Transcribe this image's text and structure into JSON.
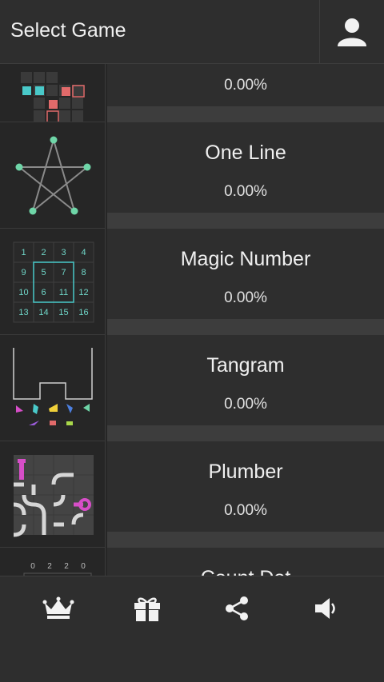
{
  "header": {
    "title": "Select Game",
    "user_icon": "user-icon"
  },
  "games": [
    {
      "name": "",
      "progress": "0.00%"
    },
    {
      "name": "One Line",
      "progress": "0.00%"
    },
    {
      "name": "Magic Number",
      "progress": "0.00%"
    },
    {
      "name": "Tangram",
      "progress": "0.00%"
    },
    {
      "name": "Plumber",
      "progress": "0.00%"
    },
    {
      "name": "Count Dot",
      "progress": ""
    }
  ],
  "magic_grid": [
    "1",
    "2",
    "3",
    "4",
    "9",
    "5",
    "7",
    "8",
    "10",
    "6",
    "11",
    "12",
    "13",
    "14",
    "15",
    "16"
  ],
  "count_dot_labels": [
    "0",
    "2",
    "2",
    "0"
  ],
  "bottom_nav": {
    "icons": [
      "crown-icon",
      "gift-icon",
      "share-icon",
      "speaker-icon"
    ]
  },
  "colors": {
    "accent_green": "#6fd6a8",
    "accent_cyan": "#49c9c9",
    "accent_red": "#e16a6a",
    "accent_pink": "#d74ec8"
  }
}
